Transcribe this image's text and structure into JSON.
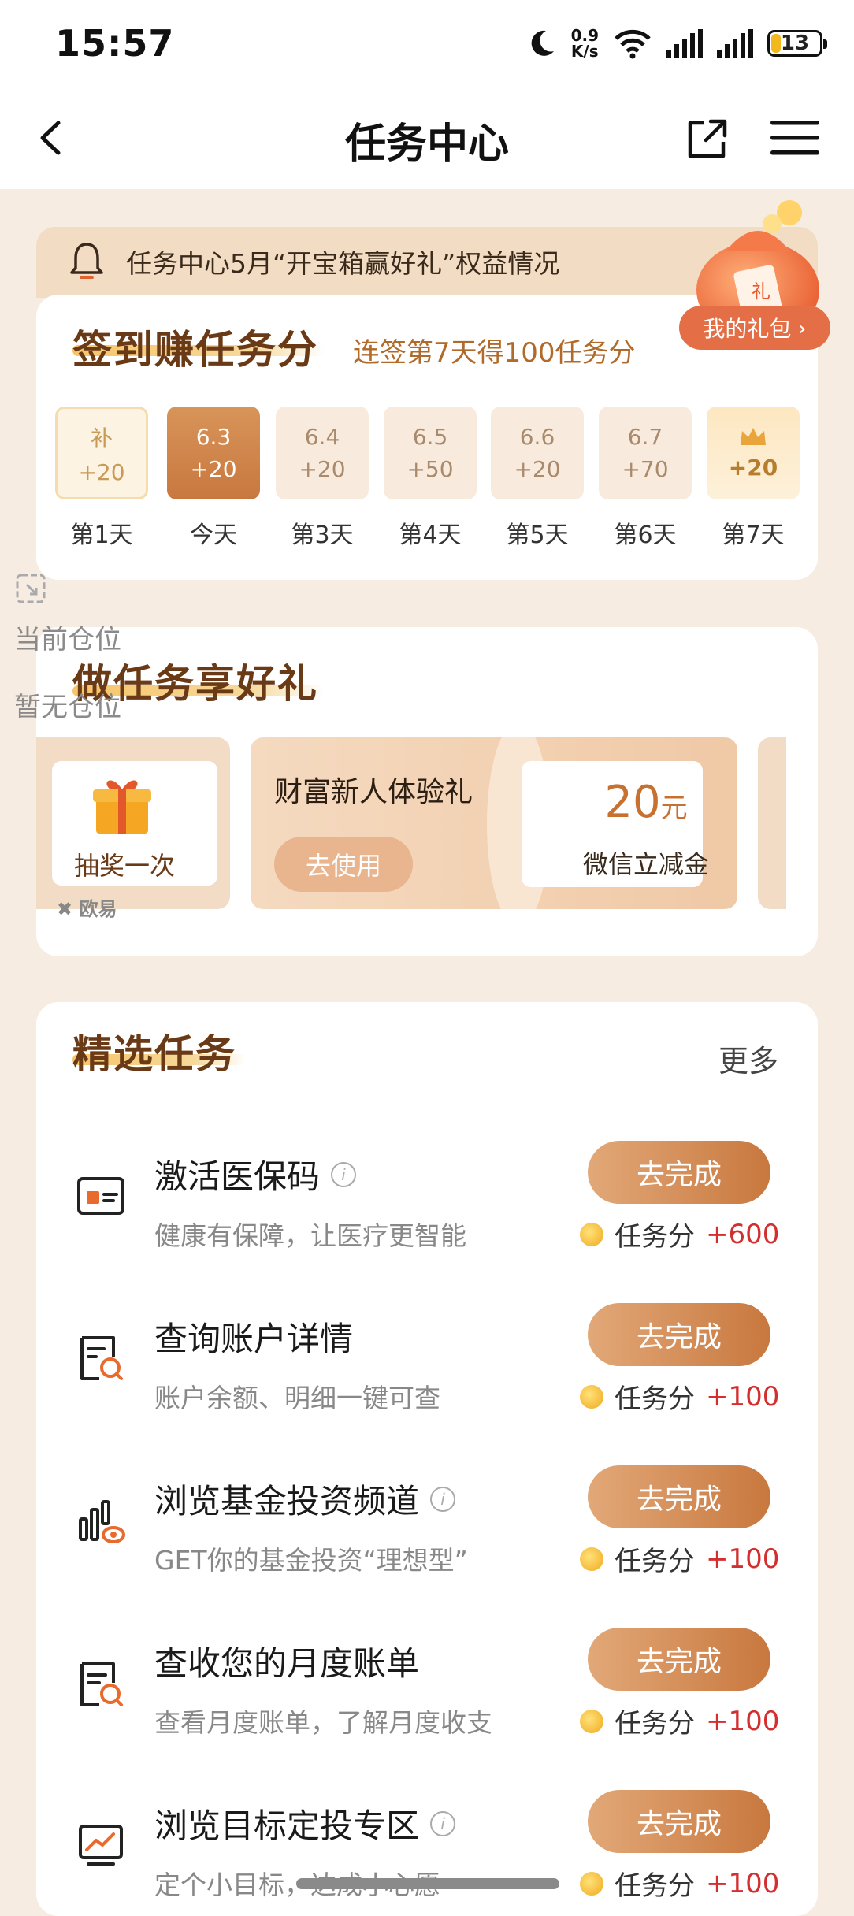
{
  "status_bar": {
    "time": "15:57",
    "net_speed_value": "0.9",
    "net_speed_unit": "K/s",
    "battery": "13"
  },
  "header": {
    "title": "任务中心"
  },
  "notice": {
    "text": "任务中心5月“开宝箱赢好礼”权益情况"
  },
  "checkin": {
    "title": "签到赚任务分",
    "subtitle": "连签第7天得100任务分",
    "my_gift": "我的礼包",
    "days": [
      {
        "top": "补",
        "points": "+20",
        "label": "第1天"
      },
      {
        "top": "6.3",
        "points": "+20",
        "label": "今天"
      },
      {
        "top": "6.4",
        "points": "+20",
        "label": "第3天"
      },
      {
        "top": "6.5",
        "points": "+50",
        "label": "第4天"
      },
      {
        "top": "6.6",
        "points": "+20",
        "label": "第5天"
      },
      {
        "top": "6.7",
        "points": "+70",
        "label": "第6天"
      },
      {
        "top": "",
        "points": "+20",
        "label": "第7天"
      }
    ]
  },
  "overlay": {
    "position_label": "当前仓位",
    "position_value": "暂无仓位",
    "badge": "欧易"
  },
  "rewards": {
    "title": "做任务享好礼",
    "lottery_label": "抽奖一次",
    "coupon_title": "财富新人体验礼",
    "coupon_button": "去使用",
    "coupon_amount": "20",
    "coupon_unit": "元",
    "coupon_desc": "微信立减金"
  },
  "tasks": {
    "title": "精选任务",
    "more": "更多",
    "points_label": "任务分",
    "items": [
      {
        "name": "激活医保码",
        "desc": "健康有保障，让医疗更智能",
        "button": "去完成",
        "points": "+600",
        "icon": "medical-card-icon"
      },
      {
        "name": "查询账户详情",
        "desc": "账户余额、明细一键可查",
        "button": "去完成",
        "points": "+100",
        "icon": "account-search-icon"
      },
      {
        "name": "浏览基金投资频道",
        "desc": "GET你的基金投资“理想型”",
        "button": "去完成",
        "points": "+100",
        "icon": "fund-chart-icon"
      },
      {
        "name": "查收您的月度账单",
        "desc": "查看月度账单，了解月度收支",
        "button": "去完成",
        "points": "+100",
        "icon": "bill-search-icon"
      },
      {
        "name": "浏览目标定投专区",
        "desc": "定个小目标，达成小心愿",
        "button": "去完成",
        "points": "+100",
        "icon": "trend-screen-icon"
      }
    ]
  }
}
